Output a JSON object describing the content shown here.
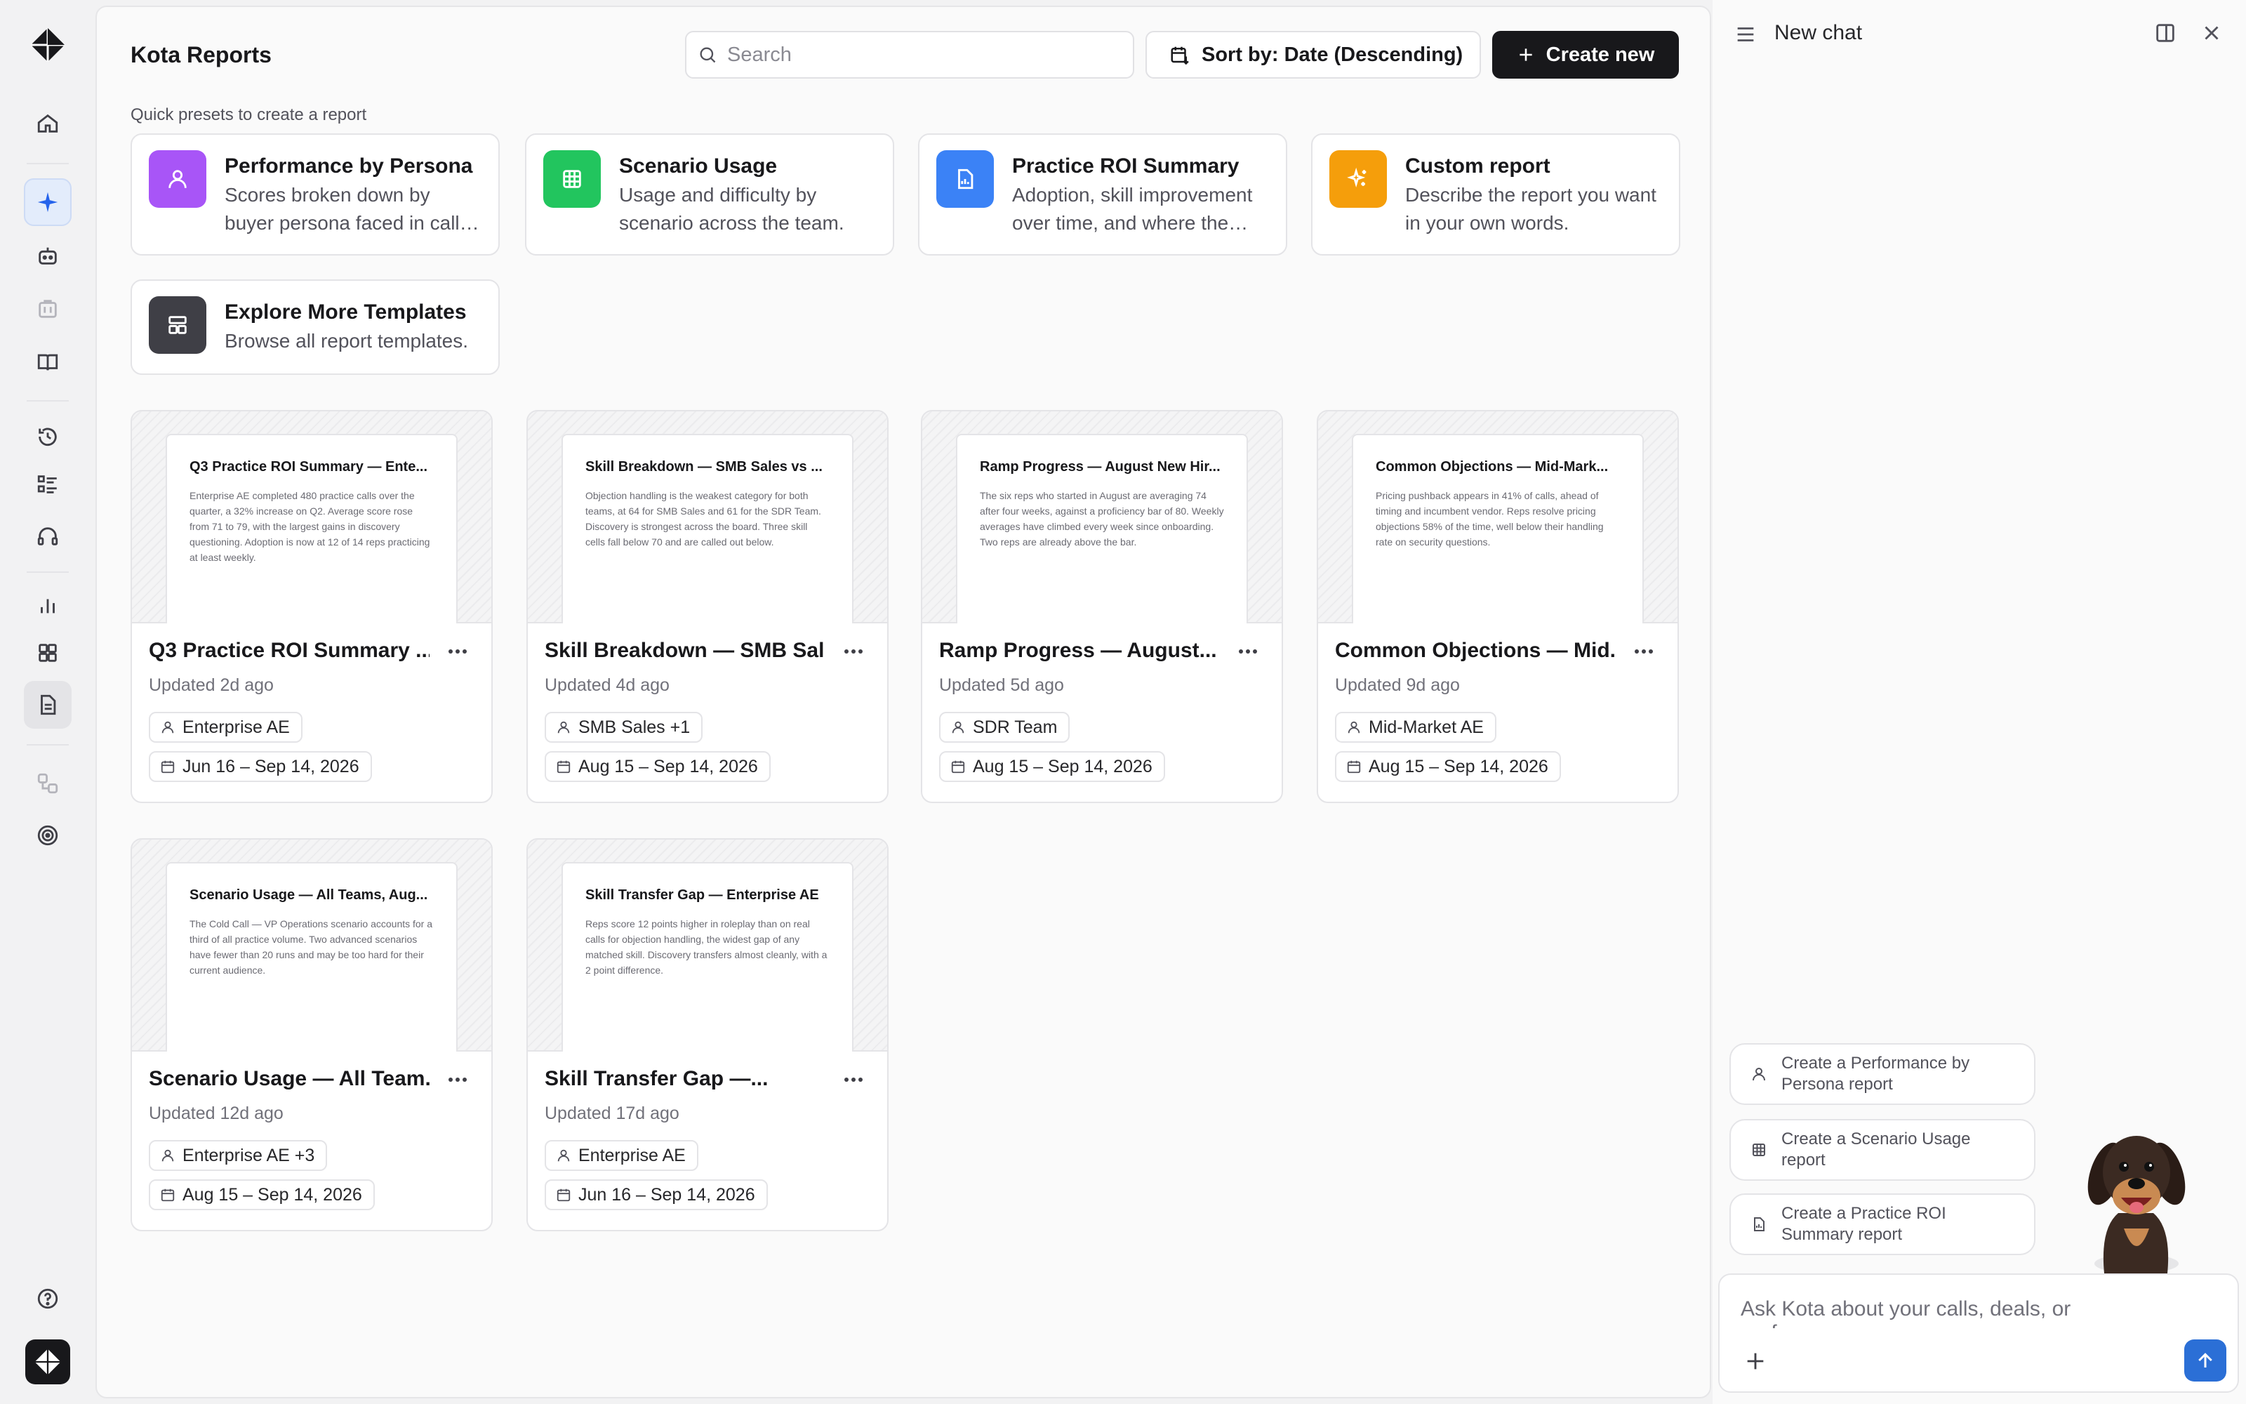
{
  "app": {
    "title": "Kota Reports"
  },
  "toolbar": {
    "search_placeholder": "Search",
    "sort_label": "Sort by: Date (Descending)",
    "create_label": "Create new"
  },
  "presets": {
    "label": "Quick presets to create a report",
    "items": [
      {
        "title": "Performance by Persona",
        "desc": "Scores broken down by buyer persona faced in calls across the team.",
        "color": "#a855f7",
        "icon": "user-icon"
      },
      {
        "title": "Scenario Usage",
        "desc": "Usage and difficulty by scenario across the team.",
        "color": "#22c55e",
        "icon": "grid-table-icon"
      },
      {
        "title": "Practice ROI Summary",
        "desc": "Adoption, skill improvement over time, and where the reps still need work.",
        "color": "#3b82f6",
        "icon": "document-icon"
      },
      {
        "title": "Custom report",
        "desc": "Describe the report you want in your own words.",
        "color": "#f59e0b",
        "icon": "sparkles-icon"
      },
      {
        "title": "Explore More Templates",
        "desc": "Browse all report templates.",
        "color": "#3f3f46",
        "icon": "template-icon"
      }
    ]
  },
  "reports": [
    {
      "thumb_title": "Q3 Practice ROI Summary — Ente...",
      "thumb_body": "Enterprise AE completed 480 practice calls over the quarter, a 32% increase on Q2. Average score rose from 71 to 79, with the largest gains in discovery questioning. Adoption is now at 12 of 14 reps practicing at least weekly.",
      "title": "Q3 Practice ROI Summary ...",
      "updated": "Updated 2d ago",
      "persona": "Enterprise AE",
      "range": "Jun 16 – Sep 14, 2026"
    },
    {
      "thumb_title": "Skill Breakdown — SMB Sales vs ...",
      "thumb_body": "Objection handling is the weakest category for both teams, at 64 for SMB Sales and 61 for the SDR Team. Discovery is strongest across the board. Three skill cells fall below 70 and are called out below.",
      "title": "Skill Breakdown — SMB Sal...",
      "updated": "Updated 4d ago",
      "persona": "SMB Sales +1",
      "range": "Aug 15 – Sep 14, 2026"
    },
    {
      "thumb_title": "Ramp Progress — August New Hir...",
      "thumb_body": "The six reps who started in August are averaging 74 after four weeks, against a proficiency bar of 80. Weekly averages have climbed every week since onboarding. Two reps are already above the bar.",
      "title": "Ramp Progress — August...",
      "updated": "Updated 5d ago",
      "persona": "SDR Team",
      "range": "Aug 15 – Sep 14, 2026"
    },
    {
      "thumb_title": "Common Objections — Mid-Mark...",
      "thumb_body": "Pricing pushback appears in 41% of calls, ahead of timing and incumbent vendor. Reps resolve pricing objections 58% of the time, well below their handling rate on security questions.",
      "title": "Common Objections — Mid...",
      "updated": "Updated 9d ago",
      "persona": "Mid-Market AE",
      "range": "Aug 15 – Sep 14, 2026"
    },
    {
      "thumb_title": "Scenario Usage — All Teams, Aug...",
      "thumb_body": "The Cold Call — VP Operations scenario accounts for a third of all practice volume. Two advanced scenarios have fewer than 20 runs and may be too hard for their current audience.",
      "title": "Scenario Usage — All Team...",
      "updated": "Updated 12d ago",
      "persona": "Enterprise AE +3",
      "range": "Aug 15 – Sep 14, 2026"
    },
    {
      "thumb_title": "Skill Transfer Gap — Enterprise AE",
      "thumb_body": "Reps score 12 points higher in roleplay than on real calls for objection handling, the widest gap of any matched skill. Discovery transfers almost cleanly, with a 2 point difference.",
      "title": "Skill Transfer Gap —...",
      "updated": "Updated 17d ago",
      "persona": "Enterprise AE",
      "range": "Jun 16 – Sep 14, 2026"
    }
  ],
  "chat": {
    "title": "New chat",
    "suggestions": [
      {
        "text": "Create a Performance by Persona report",
        "icon": "user-icon"
      },
      {
        "text": "Create a Scenario Usage report",
        "icon": "grid-table-icon"
      },
      {
        "text": "Create a Practice ROI Summary report",
        "icon": "document-icon"
      }
    ],
    "input_placeholder": "Ask Kota about your calls, deals, or performance...",
    "send_color": "#2b6fd6"
  }
}
